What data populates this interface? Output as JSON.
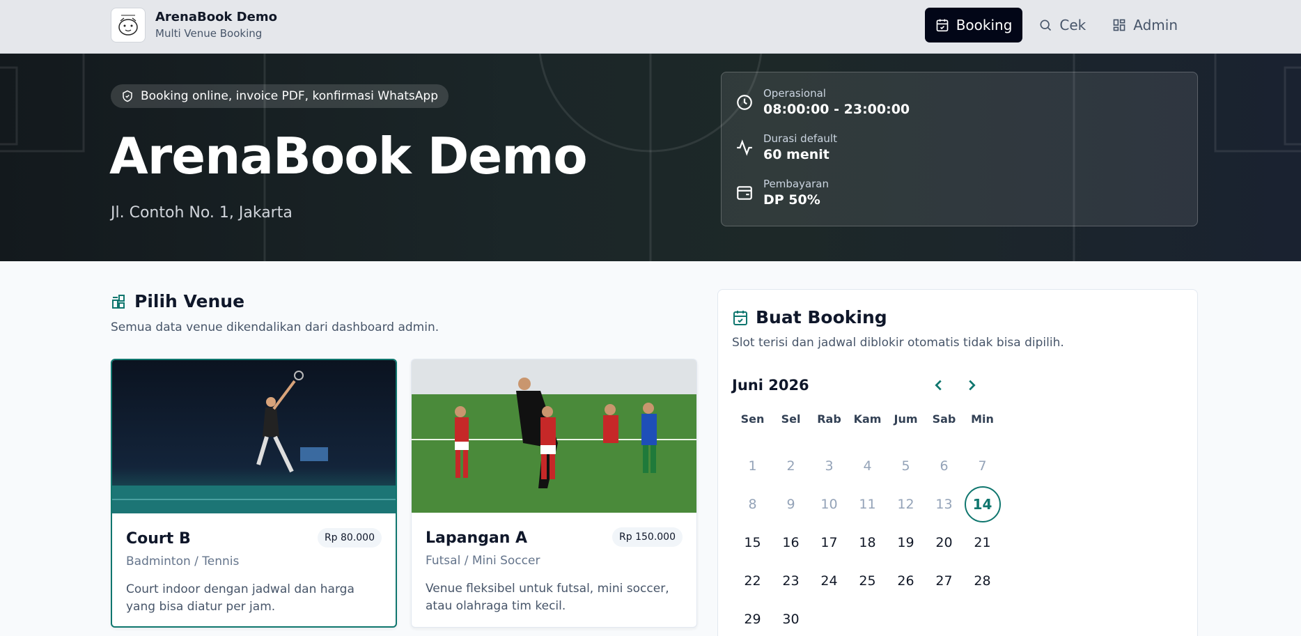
{
  "header": {
    "brand_title": "ArenaBook Demo",
    "brand_subtitle": "Multi Venue Booking",
    "nav": [
      {
        "label": "Booking",
        "icon": "calendar-check-icon",
        "active": true
      },
      {
        "label": "Cek",
        "icon": "search-icon",
        "active": false
      },
      {
        "label": "Admin",
        "icon": "dashboard-grid-icon",
        "active": false
      }
    ]
  },
  "hero": {
    "badge": "Booking online, invoice PDF, konfirmasi WhatsApp",
    "title": "ArenaBook Demo",
    "address": "Jl. Contoh No. 1, Jakarta",
    "info": [
      {
        "label": "Operasional",
        "value": "08:00:00 - 23:00:00",
        "icon": "clock-icon"
      },
      {
        "label": "Durasi default",
        "value": "60 menit",
        "icon": "activity-icon"
      },
      {
        "label": "Pembayaran",
        "value": "DP 50%",
        "icon": "wallet-icon"
      }
    ]
  },
  "venue_section": {
    "title": "Pilih Venue",
    "description": "Semua data venue dikendalikan dari dashboard admin.",
    "venues": [
      {
        "name": "Court B",
        "price": "Rp 80.000",
        "type": "Badminton / Tennis",
        "description": "Court indoor dengan jadwal dan harga yang bisa diatur per jam.",
        "selected": true
      },
      {
        "name": "Lapangan A",
        "price": "Rp 150.000",
        "type": "Futsal / Mini Soccer",
        "description": "Venue fleksibel untuk futsal, mini soccer, atau olahraga tim kecil.",
        "selected": false
      }
    ]
  },
  "booking": {
    "title": "Buat Booking",
    "description": "Slot terisi dan jadwal diblokir otomatis tidak bisa dipilih.",
    "month": "Juni 2026",
    "weekdays": [
      "Sen",
      "Sel",
      "Rab",
      "Kam",
      "Jum",
      "Sab",
      "Min"
    ],
    "days": [
      "1",
      "2",
      "3",
      "4",
      "5",
      "6",
      "7",
      "8",
      "9",
      "10",
      "11",
      "12",
      "13",
      "14",
      "15",
      "16",
      "17",
      "18",
      "19",
      "20",
      "21",
      "22",
      "23",
      "24",
      "25",
      "26",
      "27",
      "28",
      "29",
      "30"
    ],
    "today": "14",
    "accent_color": "#0f766e"
  }
}
